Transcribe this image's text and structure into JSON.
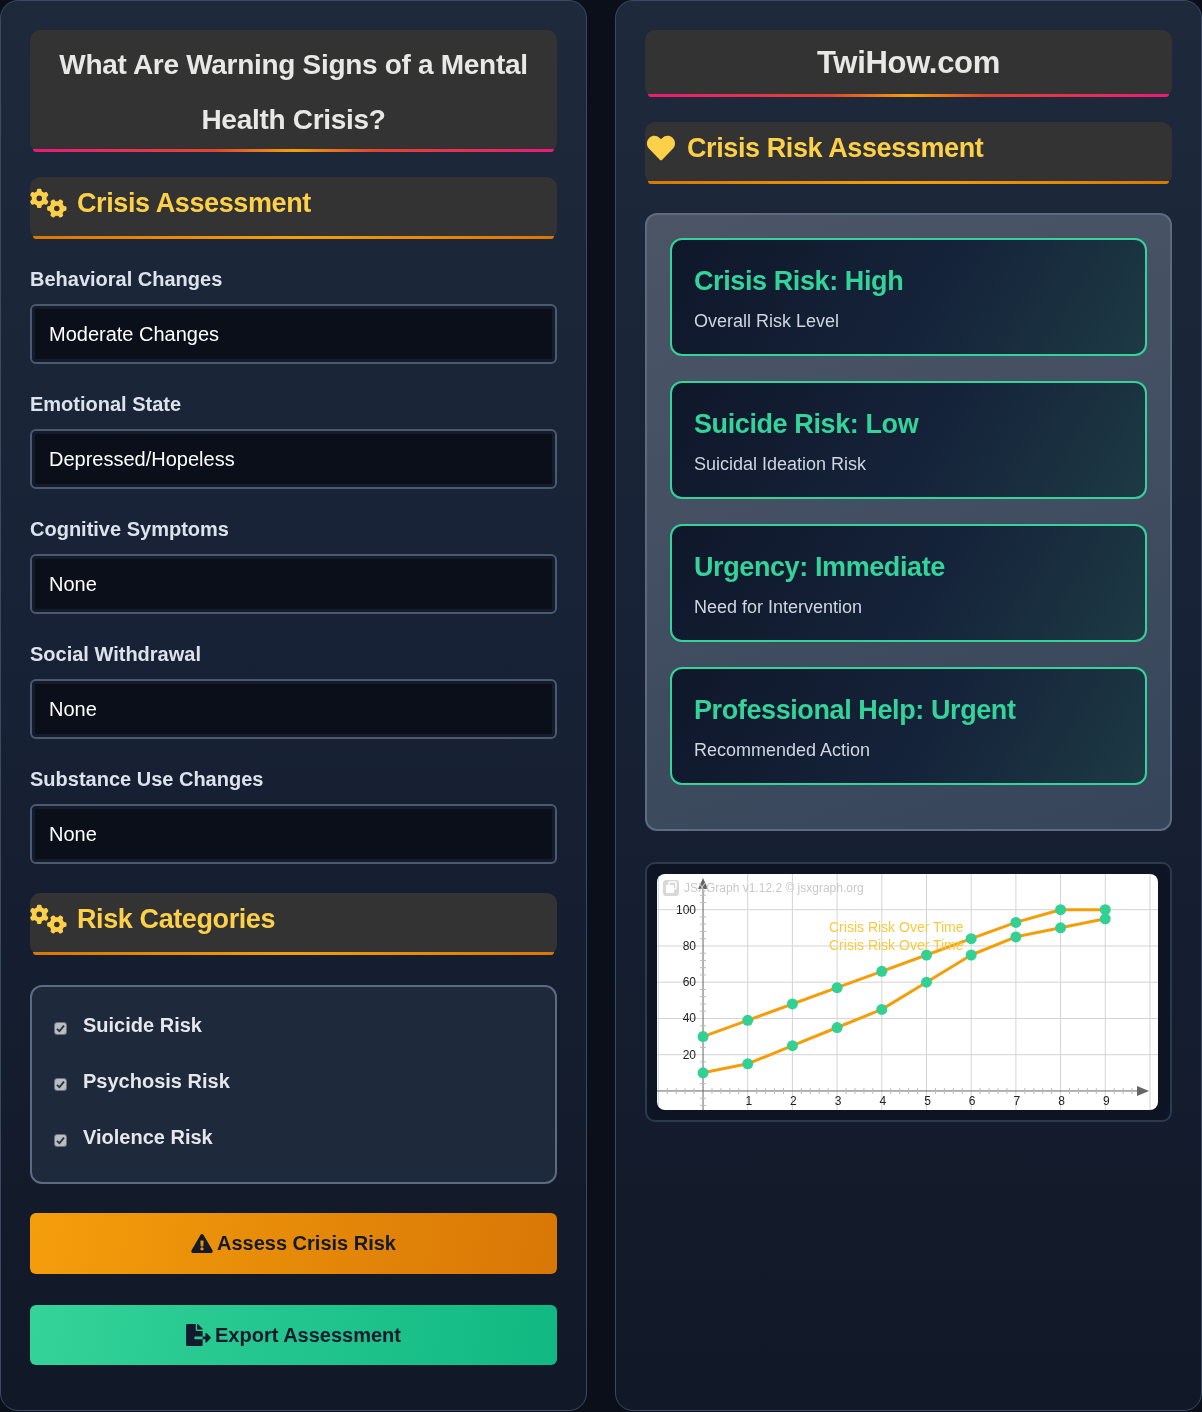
{
  "left_panel": {
    "title": "What Are Warning Signs of a Mental Health Crisis?"
  },
  "assessment": {
    "heading": "Crisis Assessment",
    "fields": [
      {
        "label": "Behavioral Changes",
        "value": "Moderate Changes"
      },
      {
        "label": "Emotional State",
        "value": "Depressed/Hopeless"
      },
      {
        "label": "Cognitive Symptoms",
        "value": "None"
      },
      {
        "label": "Social Withdrawal",
        "value": "None"
      },
      {
        "label": "Substance Use Changes",
        "value": "None"
      }
    ]
  },
  "risk_categories": {
    "heading": "Risk Categories",
    "items": [
      {
        "label": "Suicide Risk",
        "checked": true
      },
      {
        "label": "Psychosis Risk",
        "checked": true
      },
      {
        "label": "Violence Risk",
        "checked": true
      }
    ]
  },
  "buttons": [
    {
      "kind": "assess",
      "label": "Assess Crisis Risk"
    },
    {
      "kind": "export",
      "label": "Export Assessment"
    }
  ],
  "right_panel": {
    "site_title": "TwiHow.com",
    "heading": "Crisis Risk Assessment",
    "results": [
      {
        "title": "Crisis Risk: High",
        "subtitle": "Overall Risk Level"
      },
      {
        "title": "Suicide Risk: Low",
        "subtitle": "Suicidal Ideation Risk"
      },
      {
        "title": "Urgency: Immediate",
        "subtitle": "Need for Intervention"
      },
      {
        "title": "Professional Help: Urgent",
        "subtitle": "Recommended Action"
      }
    ],
    "chart": {
      "credit": "JSXGraph v1.12.2 © jsxgraph.org",
      "chart_data": {
        "type": "line",
        "grid": true,
        "x": [
          0,
          1,
          2,
          3,
          4,
          5,
          6,
          7,
          8,
          9
        ],
        "series": [
          {
            "name": "Crisis Risk Over Time",
            "color": "#f59e0b",
            "marker": "circle",
            "values": [
              30,
              39,
              48,
              57,
              66,
              75,
              84,
              93,
              100,
              100
            ]
          },
          {
            "name": "Crisis Risk Over Time",
            "color": "#f59e0b",
            "marker": "circle",
            "values": [
              10,
              15,
              25,
              35,
              45,
              60,
              75,
              85,
              90,
              95
            ]
          }
        ],
        "xlim": [
          -1.03,
          10.18
        ],
        "ylim": [
          -10.5,
          119.7
        ],
        "xticks": [
          1,
          2,
          3,
          4,
          5,
          6,
          7,
          8,
          9
        ],
        "yticks": [
          20,
          40,
          60,
          80,
          100
        ]
      }
    }
  }
}
